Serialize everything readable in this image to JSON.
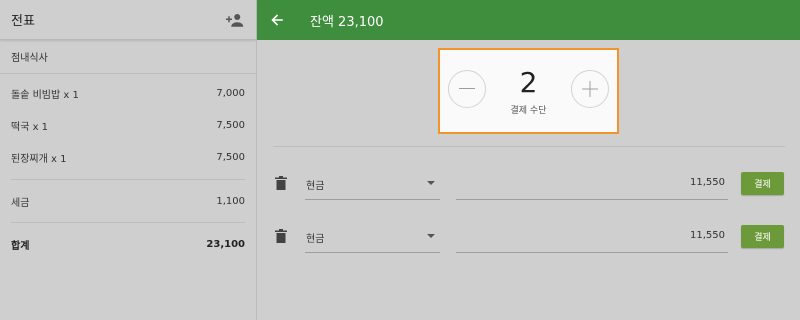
{
  "left_panel": {
    "title": "전표",
    "order_type": "점내식사",
    "items": [
      {
        "name": "돌솥 비빔밥 x 1",
        "price": "7,000"
      },
      {
        "name": "떡국 x 1",
        "price": "7,500"
      },
      {
        "name": "된장찌개 x 1",
        "price": "7,500"
      }
    ],
    "tax": {
      "label": "세금",
      "value": "1,100"
    },
    "total": {
      "label": "합계",
      "value": "23,100"
    }
  },
  "header": {
    "balance": "잔액 23,100"
  },
  "stepper": {
    "value": "2",
    "label": "결제 수단"
  },
  "payments": [
    {
      "method": "현금",
      "amount": "11,550",
      "button": "결제"
    },
    {
      "method": "현금",
      "amount": "11,550",
      "button": "결제"
    }
  ],
  "colors": {
    "header_green": "#3e8e3e",
    "pay_button_green": "#6c9a3a",
    "stepper_highlight": "#f0952c"
  },
  "icons": [
    "add-person-icon",
    "back-arrow-icon",
    "minus-icon",
    "plus-icon",
    "trash-icon",
    "dropdown-caret-icon"
  ]
}
